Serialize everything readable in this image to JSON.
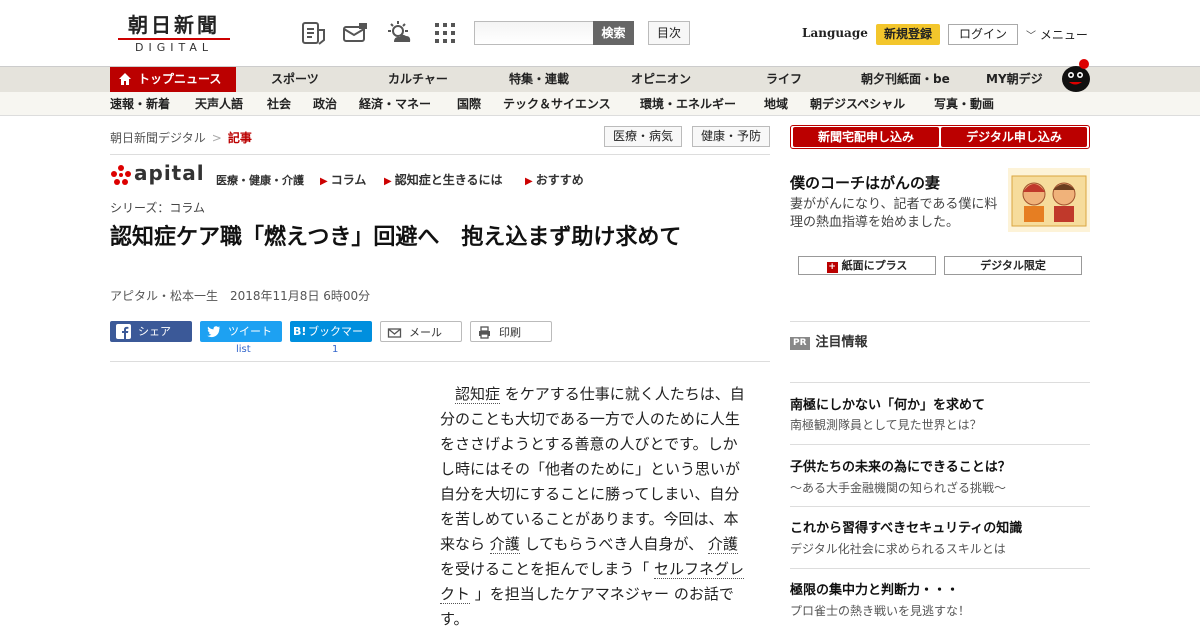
{
  "header": {
    "logo_main": "朝日新聞",
    "logo_sub": "DIGITAL",
    "search_button": "検索",
    "toc_button": "目次",
    "language": "Language",
    "signup": "新規登録",
    "login": "ログイン",
    "menu": "メニュー",
    "icons": [
      "newspaper-icon",
      "mail-icon",
      "weather-icon",
      "grid-icon"
    ]
  },
  "nav_primary": [
    "トップニュース",
    "スポーツ",
    "カルチャー",
    "特集・連載",
    "オピニオン",
    "ライフ",
    "朝夕刊紙面・be",
    "MY朝デジ"
  ],
  "nav_secondary": [
    "速報・新着",
    "天声人語",
    "社会",
    "政治",
    "経済・マネー",
    "国際",
    "テック＆サイエンス",
    "環境・エネルギー",
    "地域",
    "朝デジスペシャル",
    "写真・動画"
  ],
  "breadcrumb": {
    "home": "朝日新聞デジタル",
    "separator": ">",
    "current": "記事",
    "tags": [
      "医療・病気",
      "健康・予防"
    ]
  },
  "apital": {
    "brand": "apital",
    "tagline": "医療・健康・介護",
    "links": [
      "コラム",
      "認知症と生きるには",
      "おすすめ"
    ]
  },
  "article": {
    "series": "シリーズ：コラム",
    "title": "認知症ケア職「燃えつき」回避へ　抱え込まず助け求めて",
    "byline": "アピタル・松本一生　2018年11月8日 6時00分",
    "body": {
      "p1": "認知症",
      "p2": "をケアする仕事に就く人たちは、自分のことも大切である一方で人のために人生をささげようとする善意の人びとです。しかし時にはその「他者のために」という思いが自分を大切にすることに勝ってしまい、自分を苦しめていることがあります。今回は、本来なら",
      "p3": "介護",
      "p4": "してもらうべき人自身が、",
      "p5": "介護",
      "p6": "を受けることを拒んでしまう「",
      "p7": "セルフネグレクト",
      "p8": "」を担当したケアマネジャー",
      "p9": "のお話です。"
    }
  },
  "share": {
    "facebook": "シェア",
    "twitter": "ツイート",
    "hatena": "ブックマーク",
    "hatena_mark": "B!",
    "mail": "メール",
    "print": "印刷",
    "twitter_count": "list",
    "hatena_count": "1"
  },
  "sidebar": {
    "subscribe_paper": "新聞宅配申し込み",
    "subscribe_digital": "デジタル申し込み",
    "promo_title": "僕のコーチはがんの妻",
    "promo_desc": "妻ががんになり、記者である僕に料理の熱血指導を始めました。",
    "plus_button": "紙面にプラス",
    "digital_only": "デジタル限定",
    "pr_badge": "PR",
    "pr_heading": "注目情報",
    "ads": [
      {
        "title": "南極にしかない「何か」を求めて",
        "sub": "南極観測隊員として見た世界とは？"
      },
      {
        "title": "子供たちの未来の為にできることは？",
        "sub": "～ある大手金融機関の知られざる挑戦～"
      },
      {
        "title": "これから習得すべきセキュリティの知識",
        "sub": "デジタル化社会に求められるスキルとは"
      },
      {
        "title": "極限の集中力と判断力・・・",
        "sub": "プロ雀士の熱き戦いを見逃すな！"
      }
    ]
  },
  "colors": {
    "brand_red": "#bb0000",
    "nav_bg": "#e5e3dc",
    "signup_yellow": "#f3c62c",
    "facebook": "#3b5998",
    "twitter": "#1da1f2",
    "hatena": "#008fde"
  }
}
